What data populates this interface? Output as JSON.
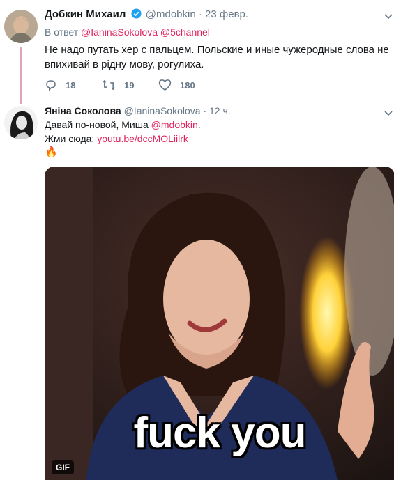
{
  "tweet1": {
    "author_name": "Добкин Михаил",
    "handle": "@mdobkin",
    "separator": "·",
    "time": "23 февр.",
    "reply_prefix": "В ответ",
    "reply_to_1": "@IaninaSokolova",
    "reply_to_2": "@5channel",
    "text_line1": "Не надо путать хер с пальцем. Польские и иные чужеродные слова не",
    "text_line2": "впихивай в рiдну мову, рогулиха.",
    "replies": "18",
    "retweets": "19",
    "likes": "180"
  },
  "tweet2": {
    "author_name": "Яніна Соколова",
    "handle": "@IaninaSokolova",
    "separator": "·",
    "time": "12 ч.",
    "text_line1": "Давай по-новой, Миша",
    "mention": "@mdobkin",
    "mention_suffix": ".",
    "text_line2_prefix": "Жми сюда:",
    "link": "youtu.be/dccMOLiilrk",
    "emoji": "🔥",
    "media_caption": "fuck you",
    "gif_badge": "GIF"
  },
  "colors": {
    "link": "#e0245e",
    "verified": "#1da1f2",
    "muted": "#657786",
    "reply_line": "#e0a4b4"
  },
  "icons": [
    "avatar",
    "verified-badge-icon",
    "chevron-down-icon",
    "reply-icon",
    "retweet-icon",
    "like-icon"
  ]
}
